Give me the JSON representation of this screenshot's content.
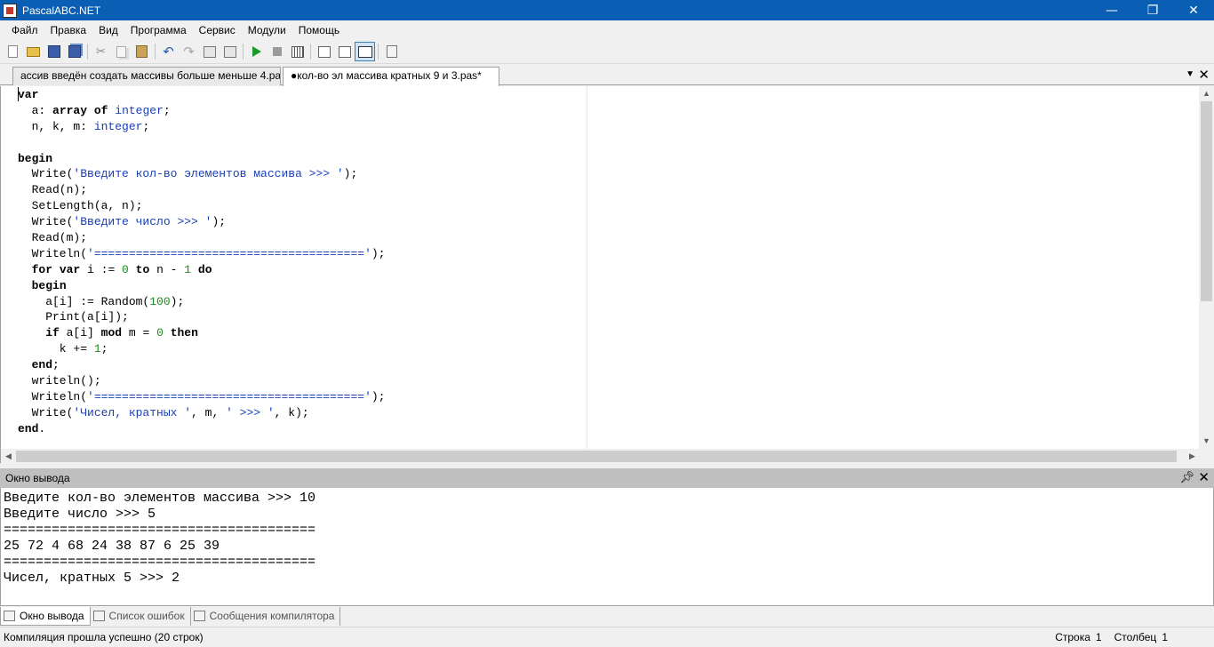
{
  "window": {
    "title": "PascalABC.NET",
    "controls": [
      "—",
      "❐",
      "✕"
    ]
  },
  "menu": [
    "Файл",
    "Правка",
    "Вид",
    "Программа",
    "Сервис",
    "Модули",
    "Помощь"
  ],
  "toolbar": {
    "icons": [
      "new-file-icon",
      "open-folder-icon",
      "save-icon",
      "save-all-icon",
      "cut-icon",
      "copy-icon",
      "paste-icon",
      "undo-icon",
      "redo-icon",
      "generate-icon",
      "run-icon",
      "stop-icon",
      "calculator-icon",
      "step-icon",
      "console-icon",
      "document-icon"
    ]
  },
  "tabs": [
    {
      "label": "ассив введён создать массивы больше меньше 4.pa",
      "active": false
    },
    {
      "label": "●кол-во эл  массива кратных 9 и 3.pas*",
      "active": true
    }
  ],
  "editor": {
    "code": [
      [
        {
          "t": "var",
          "c": "kw"
        }
      ],
      [
        {
          "t": "  a: "
        },
        {
          "t": "array",
          "c": "kw"
        },
        {
          "t": " "
        },
        {
          "t": "of",
          "c": "kw"
        },
        {
          "t": " "
        },
        {
          "t": "integer",
          "c": "ty"
        },
        {
          "t": ";"
        }
      ],
      [
        {
          "t": "  n, k, m: "
        },
        {
          "t": "integer",
          "c": "ty"
        },
        {
          "t": ";"
        }
      ],
      [
        {
          "t": ""
        }
      ],
      [
        {
          "t": "begin",
          "c": "kw"
        }
      ],
      [
        {
          "t": "  Write("
        },
        {
          "t": "'Введите кол-во элементов массива >>> '",
          "c": "st"
        },
        {
          "t": ");"
        }
      ],
      [
        {
          "t": "  Read(n);"
        }
      ],
      [
        {
          "t": "  SetLength(a, n);"
        }
      ],
      [
        {
          "t": "  Write("
        },
        {
          "t": "'Введите число >>> '",
          "c": "st"
        },
        {
          "t": ");"
        }
      ],
      [
        {
          "t": "  Read(m);"
        }
      ],
      [
        {
          "t": "  Writeln("
        },
        {
          "t": "'======================================='",
          "c": "st"
        },
        {
          "t": ");"
        }
      ],
      [
        {
          "t": "  "
        },
        {
          "t": "for",
          "c": "kw"
        },
        {
          "t": " "
        },
        {
          "t": "var",
          "c": "kw"
        },
        {
          "t": " i := "
        },
        {
          "t": "0",
          "c": "nm"
        },
        {
          "t": " "
        },
        {
          "t": "to",
          "c": "kw"
        },
        {
          "t": " n - "
        },
        {
          "t": "1",
          "c": "nm"
        },
        {
          "t": " "
        },
        {
          "t": "do",
          "c": "kw"
        }
      ],
      [
        {
          "t": "  "
        },
        {
          "t": "begin",
          "c": "kw"
        }
      ],
      [
        {
          "t": "    a[i] := Random("
        },
        {
          "t": "100",
          "c": "nm"
        },
        {
          "t": ");"
        }
      ],
      [
        {
          "t": "    Print(a[i]);"
        }
      ],
      [
        {
          "t": "    "
        },
        {
          "t": "if",
          "c": "kw"
        },
        {
          "t": " a[i] "
        },
        {
          "t": "mod",
          "c": "kw"
        },
        {
          "t": " m = "
        },
        {
          "t": "0",
          "c": "nm"
        },
        {
          "t": " "
        },
        {
          "t": "then",
          "c": "kw"
        }
      ],
      [
        {
          "t": "      k += "
        },
        {
          "t": "1",
          "c": "nm"
        },
        {
          "t": ";"
        }
      ],
      [
        {
          "t": "  "
        },
        {
          "t": "end",
          "c": "kw"
        },
        {
          "t": ";"
        }
      ],
      [
        {
          "t": "  writeln();"
        }
      ],
      [
        {
          "t": "  Writeln("
        },
        {
          "t": "'======================================='",
          "c": "st"
        },
        {
          "t": ");"
        }
      ],
      [
        {
          "t": "  Write("
        },
        {
          "t": "'Чисел, кратных '",
          "c": "st"
        },
        {
          "t": ", m, "
        },
        {
          "t": "' >>> '",
          "c": "st"
        },
        {
          "t": ", k);"
        }
      ],
      [
        {
          "t": "end",
          "c": "kw"
        },
        {
          "t": "."
        }
      ]
    ]
  },
  "output": {
    "title": "Окно вывода",
    "lines": [
      "Введите кол-во элементов массива >>> 10",
      "Введите число >>> 5",
      "=======================================",
      "25 72 4 68 24 38 87 6 25 39",
      "=======================================",
      "Чисел, кратных 5 >>> 2"
    ]
  },
  "bottom_tabs": [
    {
      "label": "Окно вывода",
      "active": true
    },
    {
      "label": "Список ошибок",
      "active": false
    },
    {
      "label": "Сообщения компилятора",
      "active": false
    }
  ],
  "status": {
    "message": "Компиляция прошла успешно (20 строк)",
    "row_label": "Строка",
    "row": "1",
    "col_label": "Столбец",
    "col": "1"
  }
}
